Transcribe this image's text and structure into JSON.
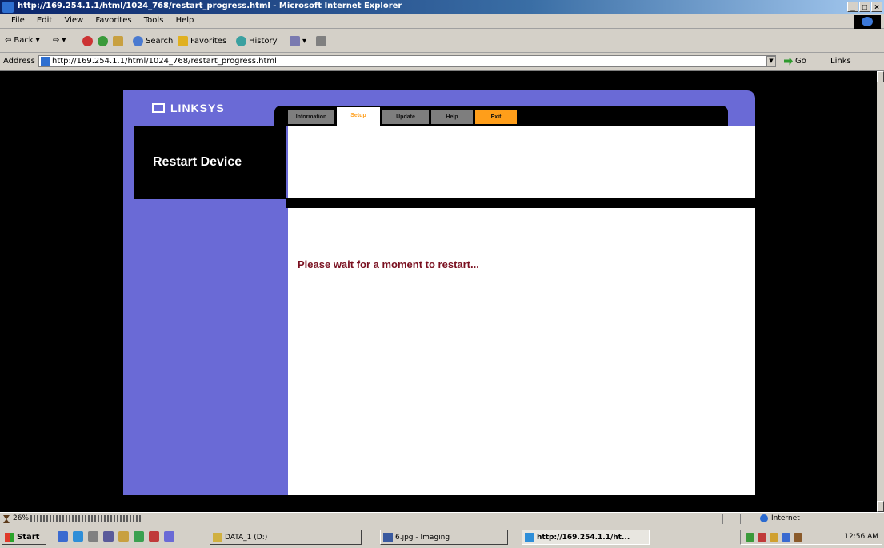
{
  "window": {
    "title": "http://169.254.1.1/html/1024_768/restart_progress.html - Microsoft Internet Explorer",
    "controls": [
      "_",
      "□",
      "×"
    ]
  },
  "menu": [
    "File",
    "Edit",
    "View",
    "Favorites",
    "Tools",
    "Help"
  ],
  "toolbar": {
    "back": "Back",
    "search": "Search",
    "favorites": "Favorites",
    "history": "History"
  },
  "address": {
    "label": "Address",
    "url": "http://169.254.1.1/html/1024_768/restart_progress.html",
    "go": "Go",
    "links": "Links"
  },
  "page": {
    "brand": "LINKSYS",
    "tabs": [
      "Information",
      "Setup",
      "Update",
      "Help",
      "Exit"
    ],
    "active_tab": "Setup",
    "section_title": "Restart Device",
    "message": "Please wait for a moment to restart..."
  },
  "status": {
    "progress_text": "26%",
    "progress_value": 0.26,
    "zone": "Internet"
  },
  "taskbar": {
    "start": "Start",
    "buttons": [
      {
        "label": "DATA_1 (D:)"
      },
      {
        "label": "6.jpg - Imaging"
      },
      {
        "label": "http://169.254.1.1/ht..."
      }
    ],
    "clock": "12:56 AM"
  },
  "colors": {
    "accent_orange": "#ff9e1a",
    "panel_purple": "#6a6ad6",
    "message_red": "#7a1020"
  }
}
